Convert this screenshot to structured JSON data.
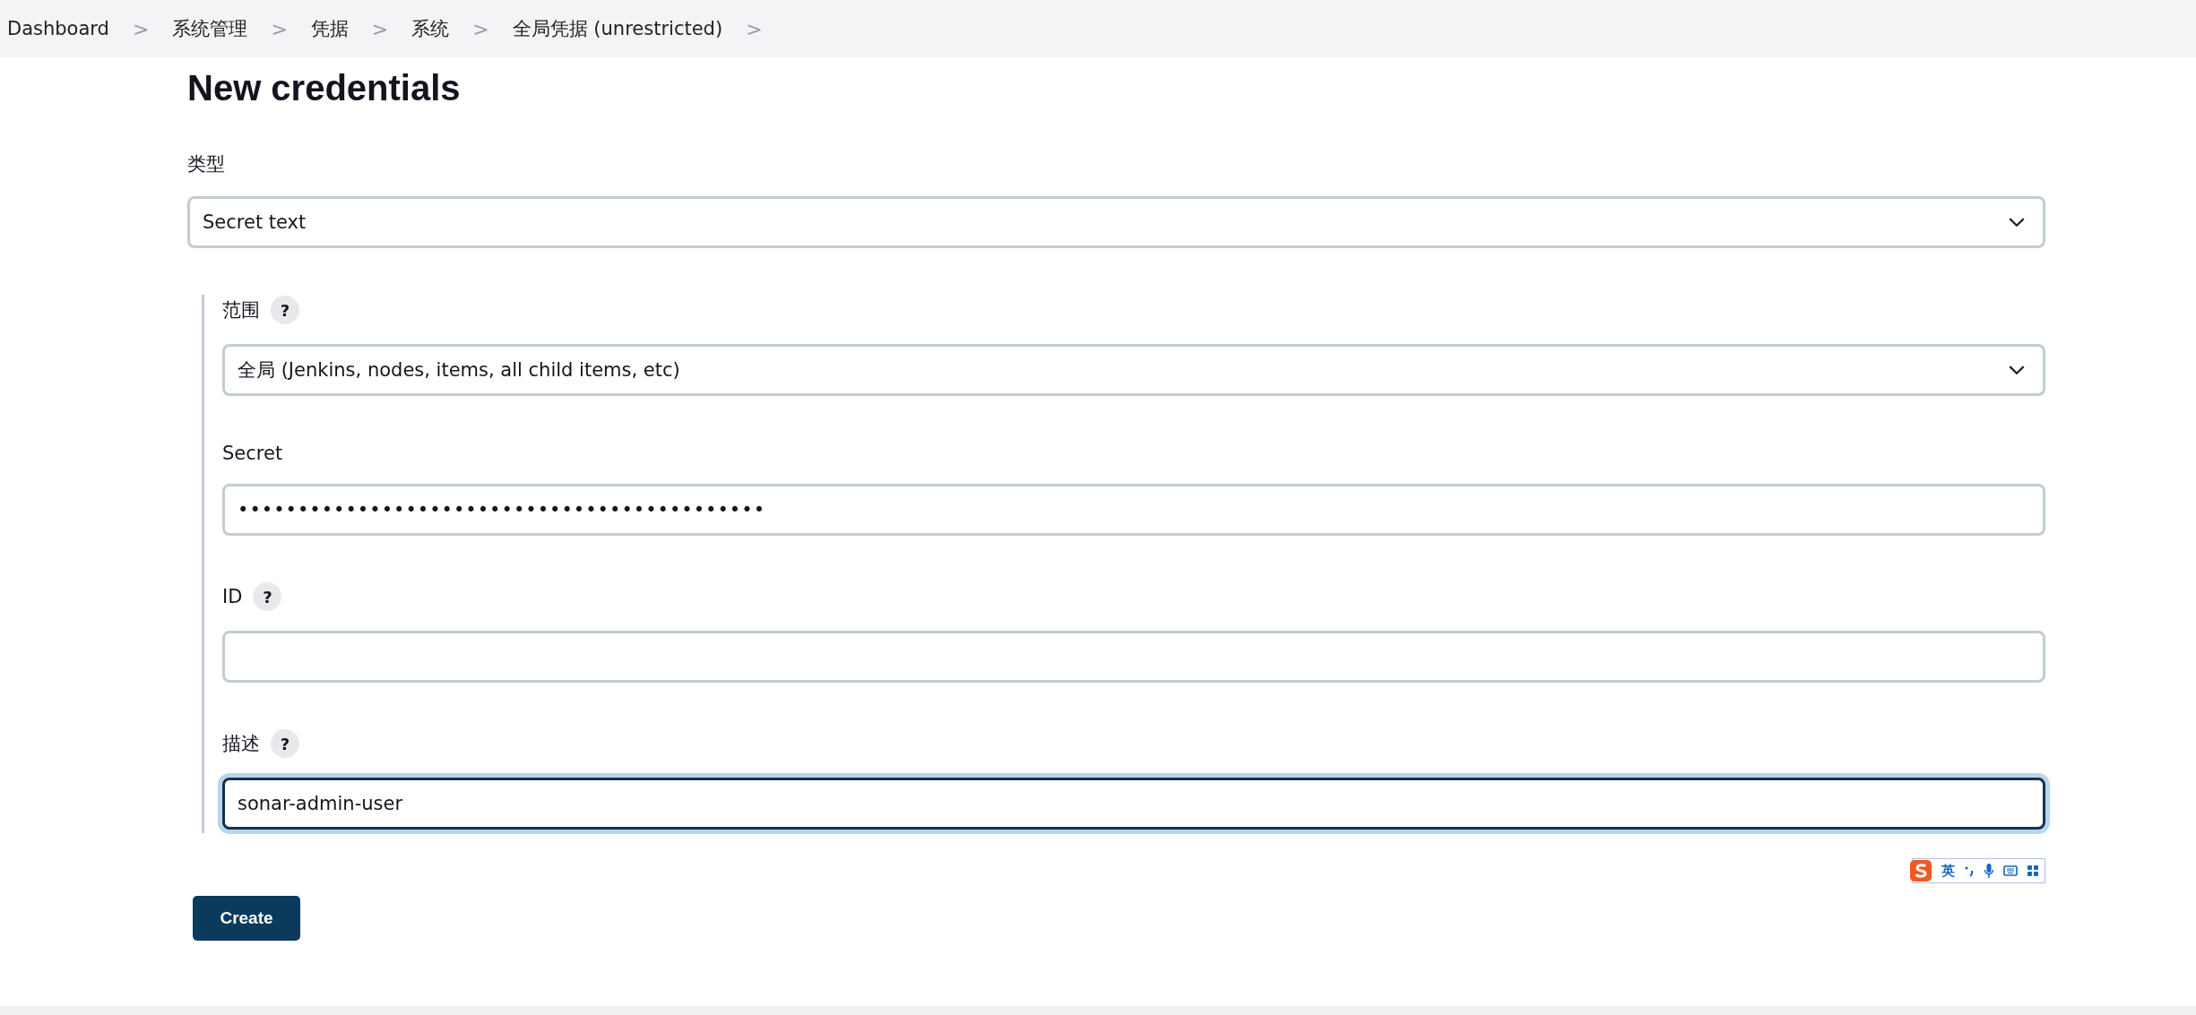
{
  "breadcrumbs": [
    {
      "label": "Dashboard",
      "separator": ">"
    },
    {
      "label": "系统管理",
      "separator": ">"
    },
    {
      "label": "凭据",
      "separator": ">"
    },
    {
      "label": "系统",
      "separator": ">"
    },
    {
      "label": "全局凭据 (unrestricted)",
      "separator": ">"
    }
  ],
  "title": "New credentials",
  "type_field": {
    "label": "类型",
    "value": "Secret text"
  },
  "fields": [
    {
      "kind": "select",
      "label": "范围",
      "help": "?",
      "value": "全局 (Jenkins, nodes, items, all child items, etc)",
      "focused": false
    },
    {
      "kind": "password",
      "label": "Secret",
      "value": "••••••••••••••••••••••••••••••••••••••••••••",
      "focused": false
    },
    {
      "kind": "text",
      "label": "ID",
      "help": "?",
      "focused": false
    },
    {
      "kind": "text",
      "label": "描述",
      "help": "?",
      "value": "sonar-admin-user",
      "focused": true
    }
  ],
  "ime_toolbar": {
    "mode": "英"
  },
  "submit_button": "Create"
}
